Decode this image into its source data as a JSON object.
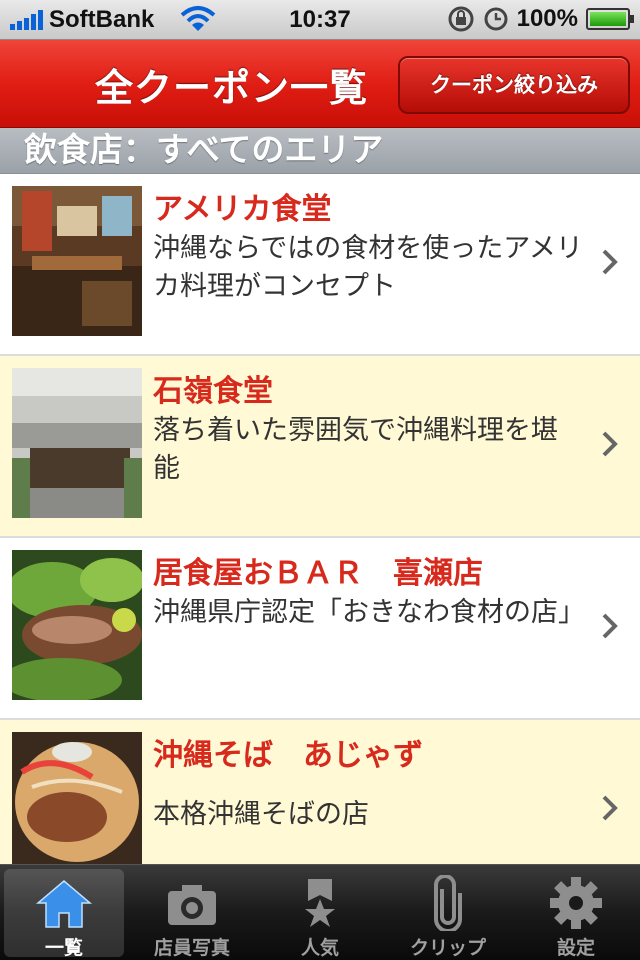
{
  "status_bar": {
    "carrier": "SoftBank",
    "time": "10:37",
    "battery": "100%"
  },
  "nav": {
    "title": "全クーポン一覧",
    "filter_button": "クーポン絞り込み"
  },
  "section": {
    "header": "飲食店：すべてのエリア"
  },
  "items": [
    {
      "title": "アメリカ食堂",
      "desc": "沖縄ならではの食材を使ったアメリカ料理がコンセプト"
    },
    {
      "title": "石嶺食堂",
      "desc": "落ち着いた雰囲気で沖縄料理を堪能"
    },
    {
      "title": "居食屋おＢＡＲ　喜瀬店",
      "desc": "沖縄県庁認定「おきなわ食材の店」"
    },
    {
      "title": "沖縄そば　あじゃず",
      "desc": "本格沖縄そばの店"
    }
  ],
  "tabs": [
    {
      "label": "一覧",
      "icon": "home-icon"
    },
    {
      "label": "店員写真",
      "icon": "camera-icon"
    },
    {
      "label": "人気",
      "icon": "ribbon-star-icon"
    },
    {
      "label": "クリップ",
      "icon": "paperclip-icon"
    },
    {
      "label": "設定",
      "icon": "gear-icon"
    }
  ],
  "colors": {
    "nav_red": "#e01e14",
    "title_red": "#d7291c",
    "cream_row": "#fff9d6",
    "tab_active": "#3a8fe8"
  }
}
